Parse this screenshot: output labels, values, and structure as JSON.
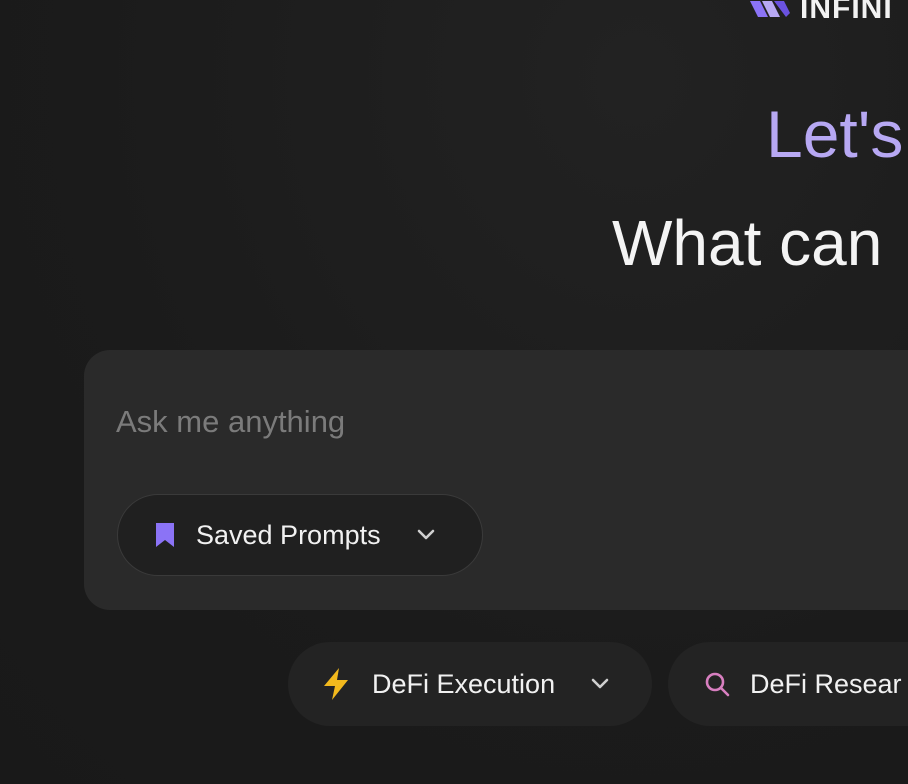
{
  "header": {
    "brand_name": "INFINI",
    "brand_icon": "infini-logo-icon"
  },
  "hero": {
    "greeting": "Let's",
    "headline": "What can"
  },
  "composer": {
    "placeholder": "Ask me anything",
    "value": "",
    "saved_prompts": {
      "label": "Saved Prompts",
      "icon": "bookmark-icon",
      "dropdown_icon": "chevron-down-icon"
    }
  },
  "modes": [
    {
      "label": "DeFi Execution",
      "icon": "lightning-icon",
      "dropdown_icon": "chevron-down-icon"
    },
    {
      "label": "DeFi Resear",
      "icon": "search-icon"
    }
  ],
  "colors": {
    "background": "#1c1c1c",
    "card": "#2a2a2a",
    "accent_purple": "#8b73f6",
    "greeting_lavender": "#b7a8f3",
    "lightning_yellow": "#f2b91d",
    "search_pink": "#d87fc0"
  }
}
